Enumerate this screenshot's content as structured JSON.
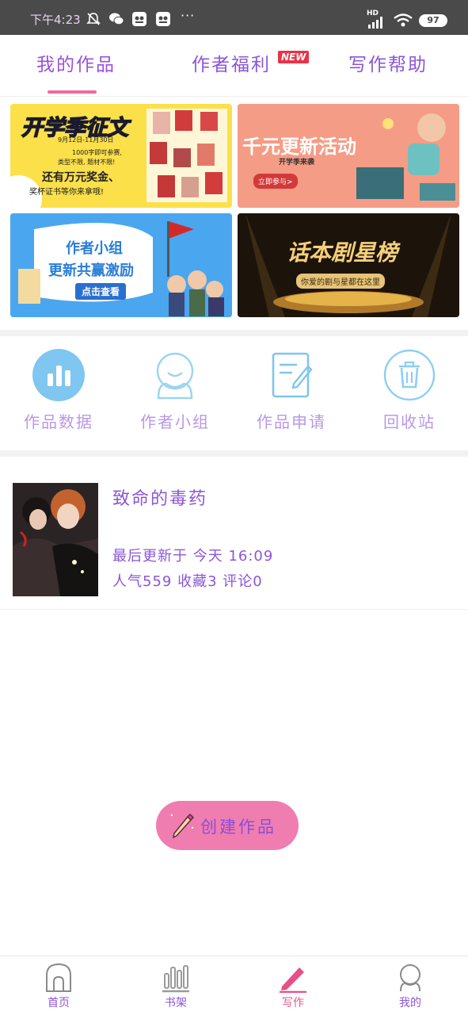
{
  "status_bar": {
    "time": "下午4:23",
    "dots": "···",
    "battery": "97",
    "network": "HD"
  },
  "tabs": [
    {
      "label": "我的作品",
      "active": true
    },
    {
      "label": "作者福利",
      "active": false,
      "badge": "NEW"
    },
    {
      "label": "写作帮助",
      "active": false
    }
  ],
  "banners": {
    "b1": {
      "title": "开学季征文",
      "date": "9月12日-11月30日",
      "line1": "1000字即可参赛,",
      "line2": "类型不限, 题材不限!",
      "line3": "还有万元奖金、",
      "line4": "奖杯证书等你来拿哦!"
    },
    "b2": {
      "title": "千元更新活动",
      "sub": "开学季来袭",
      "cta": "立即参与>"
    },
    "b3": {
      "title1": "作者小组",
      "title2": "更新共赢激励",
      "cta": "点击查看"
    },
    "b4": {
      "title": "话本剧星榜",
      "sub": "你爱的剧与星都在这里"
    }
  },
  "features": [
    {
      "label": "作品数据",
      "icon": "bar-chart-icon"
    },
    {
      "label": "作者小组",
      "icon": "group-avatar-icon"
    },
    {
      "label": "作品申请",
      "icon": "edit-document-icon"
    },
    {
      "label": "回收站",
      "icon": "trash-icon"
    }
  ],
  "work": {
    "title": "致命的毒药",
    "updated": "最后更新于 今天 16:09",
    "stats": "人气559 收藏3 评论0"
  },
  "create_button": {
    "label": "创建作品"
  },
  "bottom_nav": [
    {
      "label": "首页",
      "icon": "home-icon",
      "active": false
    },
    {
      "label": "书架",
      "icon": "bookshelf-icon",
      "active": false
    },
    {
      "label": "写作",
      "icon": "pen-icon",
      "active": true
    },
    {
      "label": "我的",
      "icon": "profile-icon",
      "active": false
    }
  ],
  "colors": {
    "accent_purple": "#8a56d9",
    "accent_pink": "#ef6a9a",
    "icon_blue": "#6fc0ec",
    "create_button": "#f07db0"
  }
}
